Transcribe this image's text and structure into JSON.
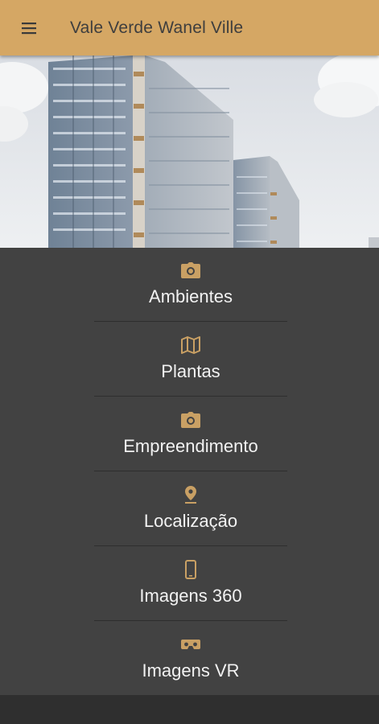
{
  "app_bar": {
    "title": "Vale Verde Wanel Ville",
    "menu_icon": "hamburger-menu-icon",
    "background_color": "#d5a764"
  },
  "hero": {
    "image": "building-photo"
  },
  "menu": {
    "background_color": "#424242",
    "icon_color": "#c9a064",
    "items": [
      {
        "label": "Ambientes",
        "icon": "camera-icon"
      },
      {
        "label": "Plantas",
        "icon": "map-icon"
      },
      {
        "label": "Empreendimento",
        "icon": "camera-icon"
      },
      {
        "label": "Localização",
        "icon": "location-pin-icon"
      },
      {
        "label": "Imagens 360",
        "icon": "smartphone-icon"
      },
      {
        "label": "Imagens VR",
        "icon": "vr-headset-icon"
      }
    ]
  }
}
